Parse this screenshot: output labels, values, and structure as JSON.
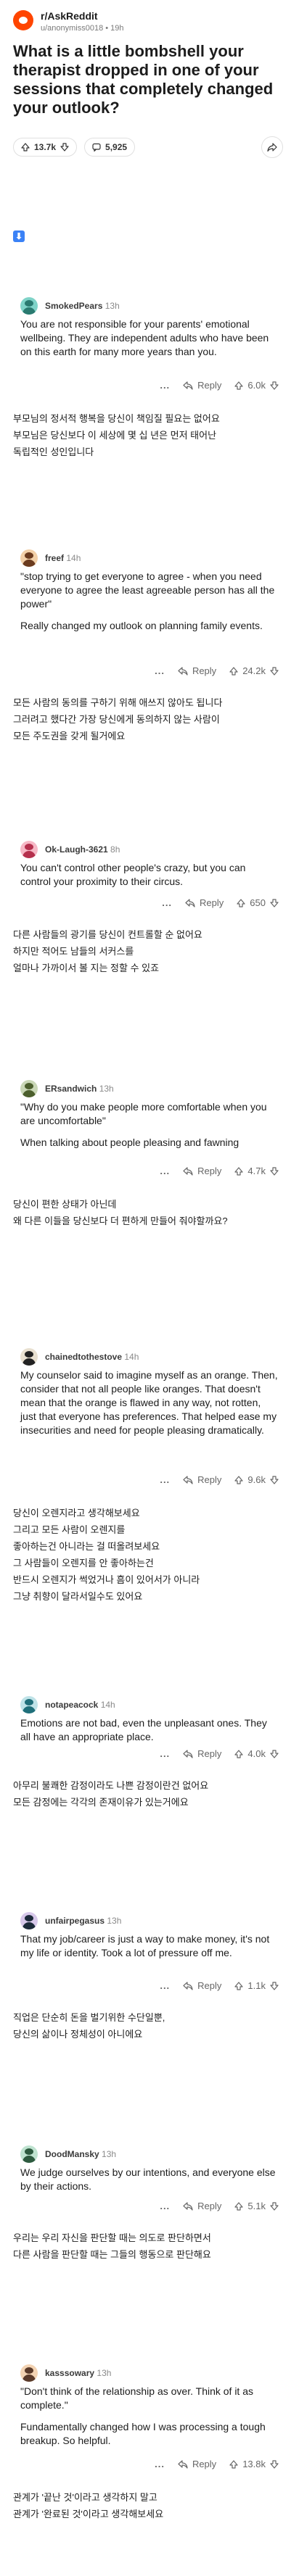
{
  "post": {
    "subreddit": "r/AskReddit",
    "meta": "u/anonymiss0018 • 19h",
    "title": "What is a little bombshell your therapist dropped in one of your sessions that completely changed your outlook?",
    "votes": "13.7k",
    "comments": "5,925"
  },
  "ui": {
    "reply_label": "Reply",
    "more_label": "..."
  },
  "colors": {
    "accent": "#ff4500",
    "badge": "#3b82f6"
  },
  "comments": [
    {
      "user": "SmokedPears",
      "age": "13h",
      "votes": "6.0k",
      "body": [
        "You are not responsible for your parents' emotional wellbeing. They are independent adults who have been on this earth for many more years than you."
      ],
      "translation": [
        "부모님의 정서적 행복을 당신이 책임질 필요는 없어요",
        "부모님은 당신보다 이 세상에 몇 십 년은 먼저 태어난",
        "독립적인 성인입니다"
      ]
    },
    {
      "user": "freef",
      "age": "14h",
      "votes": "24.2k",
      "body": [
        "\"stop trying to get everyone to agree - when you need everyone to agree the least agreeable person has all the power\"",
        "Really changed my outlook on planning family events."
      ],
      "translation": [
        "모든 사람의 동의를 구하기 위해 애쓰지 않아도 됩니다",
        "그러려고 했다간 가장 당신에게 동의하지 않는 사람이",
        "모든 주도권을 갖게 될거에요"
      ]
    },
    {
      "user": "Ok-Laugh-3621",
      "age": "8h",
      "votes": "650",
      "body": [
        "You can't control other people's crazy, but you can control your proximity to their circus."
      ],
      "translation": [
        "다른 사람들의 광기를 당신이 컨트롤할 순 없어요",
        "하지만 적어도 남들의 서커스를",
        "얼마나 가까이서 볼 지는 정할 수 있죠"
      ]
    },
    {
      "user": "ERsandwich",
      "age": "13h",
      "votes": "4.7k",
      "body": [
        "\"Why do you make people more comfortable when you are uncomfortable\"",
        "When talking about people pleasing and fawning"
      ],
      "translation": [
        "당신이 편한 상태가 아닌데",
        "왜 다른 이들을 당신보다 더 편하게 만들어 줘야할까요?"
      ]
    },
    {
      "user": "chainedtothestove",
      "age": "14h",
      "votes": "9.6k",
      "body": [
        "My counselor said to imagine myself as an orange. Then, consider that not all people like oranges. That doesn't mean that the orange is flawed in any way, not rotten, just that everyone has preferences. That helped ease my insecurities and need for people pleasing dramatically."
      ],
      "translation": [
        "당신이 오렌지라고 생각해보세요",
        "그리고 모든 사람이 오렌지를",
        "좋아하는건 아니라는 걸 떠올려보세요",
        "그 사람들이 오렌지를 안 좋아하는건",
        "반드시 오렌지가 썩었거나 흠이 있어서가 아니라",
        "그냥 취향이 달라서일수도 있어요"
      ]
    },
    {
      "user": "notapeacock",
      "age": "14h",
      "votes": "4.0k",
      "body": [
        "Emotions are not bad, even the unpleasant ones. They all have an appropriate place."
      ],
      "translation": [
        "아무리 불쾌한 감정이라도 나쁜 감정이란건 없어요",
        "모든 감정에는 각각의 존재이유가 있는거에요"
      ]
    },
    {
      "user": "unfairpegasus",
      "age": "13h",
      "votes": "1.1k",
      "body": [
        "That my job/career is just a way to make money, it's not my life or identity. Took a lot of pressure off me."
      ],
      "translation": [
        "직업은 단순히 돈을 벌기위한 수단일뿐,",
        "당신의 삶이나 정체성이 아니에요"
      ]
    },
    {
      "user": "DoodMansky",
      "age": "13h",
      "votes": "5.1k",
      "body": [
        "We judge ourselves by our intentions, and everyone else by their actions."
      ],
      "translation": [
        "우리는 우리 자신을 판단할 때는 의도로 판단하면서",
        "다른 사람을 판단할 때는 그들의 행동으로 판단해요"
      ]
    },
    {
      "user": "kasssowary",
      "age": "13h",
      "votes": "13.8k",
      "body": [
        "\"Don't think of the relationship as over. Think of it as complete.\"",
        "Fundamentally changed how I was processing a tough breakup. So helpful."
      ],
      "translation": [
        "관계가 '끝난 것'이라고 생각하지 말고",
        "관계가 '완료된 것'이라고 생각해보세요"
      ]
    }
  ]
}
